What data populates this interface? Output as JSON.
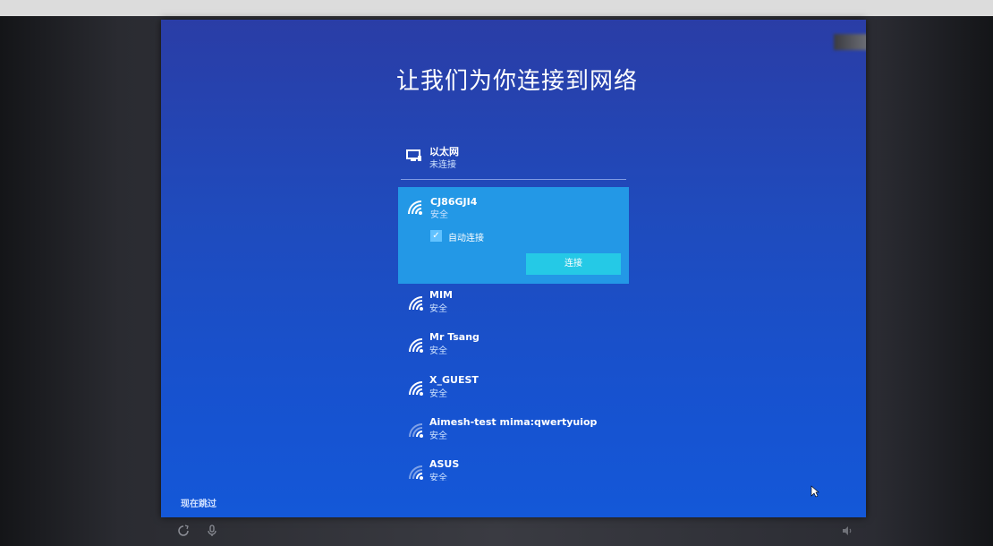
{
  "page": {
    "title": "让我们为你连接到网络",
    "skip_label": "现在跳过"
  },
  "ethernet": {
    "name": "以太网",
    "status": "未连接",
    "icon": "ethernet-icon"
  },
  "selected_network": {
    "name": "CJ86GJI4",
    "status": "安全",
    "auto_connect_label": "自动连接",
    "auto_connect_checked": true,
    "connect_label": "连接",
    "icon": "wifi-icon"
  },
  "networks": [
    {
      "name": "MIM",
      "status": "安全"
    },
    {
      "name": "Mr Tsang",
      "status": "安全"
    },
    {
      "name": "X_GUEST",
      "status": "安全"
    },
    {
      "name": "Aimesh-test mima:qwertyuiop",
      "status": "安全"
    },
    {
      "name": "ASUS",
      "status": "安全"
    }
  ],
  "colors": {
    "background": "#1f4bbd",
    "selected_card": "#2398e6",
    "connect_button": "#25c9e6"
  }
}
